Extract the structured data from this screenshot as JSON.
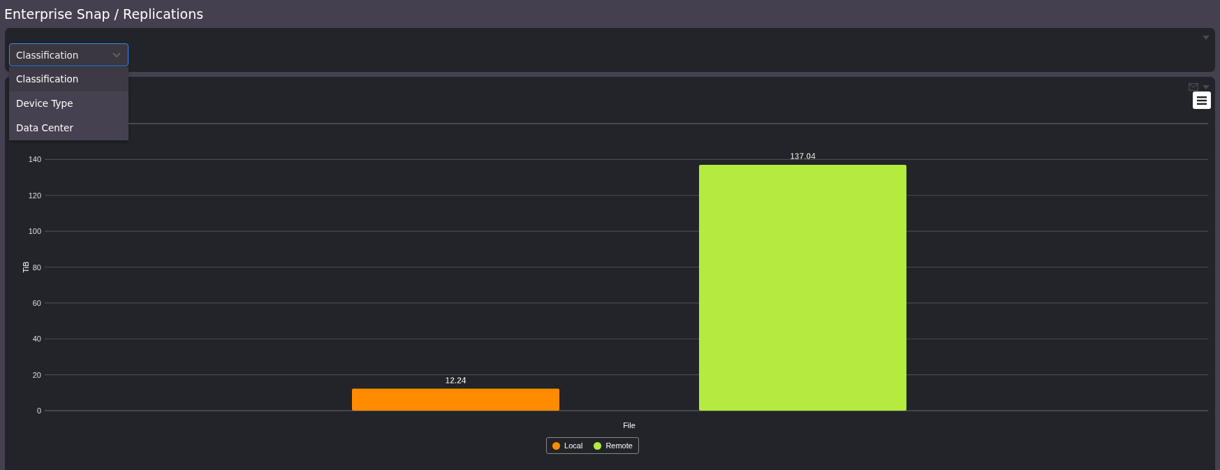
{
  "page": {
    "title": "Enterprise Snap / Replications"
  },
  "filter": {
    "select": {
      "value": "Classification",
      "expanded": true
    },
    "options": [
      {
        "label": "Classification",
        "selected": true
      },
      {
        "label": "Device Type",
        "selected": false
      },
      {
        "label": "Data Center",
        "selected": false
      }
    ]
  },
  "chart_panel": {
    "chart_data": {
      "type": "bar",
      "ylabel": "TiB",
      "categories": [
        "File"
      ],
      "grid": true,
      "legend": true,
      "series": [
        {
          "name": "Local",
          "color": "#ff8c00",
          "values": [
            12.24
          ]
        },
        {
          "name": "Remote",
          "color": "#b3eb3e",
          "values": [
            137.04
          ]
        }
      ],
      "ylim": [
        0,
        160
      ],
      "yticks": [
        0,
        20,
        40,
        60,
        80,
        100,
        120,
        140
      ],
      "data_labels": true
    }
  }
}
